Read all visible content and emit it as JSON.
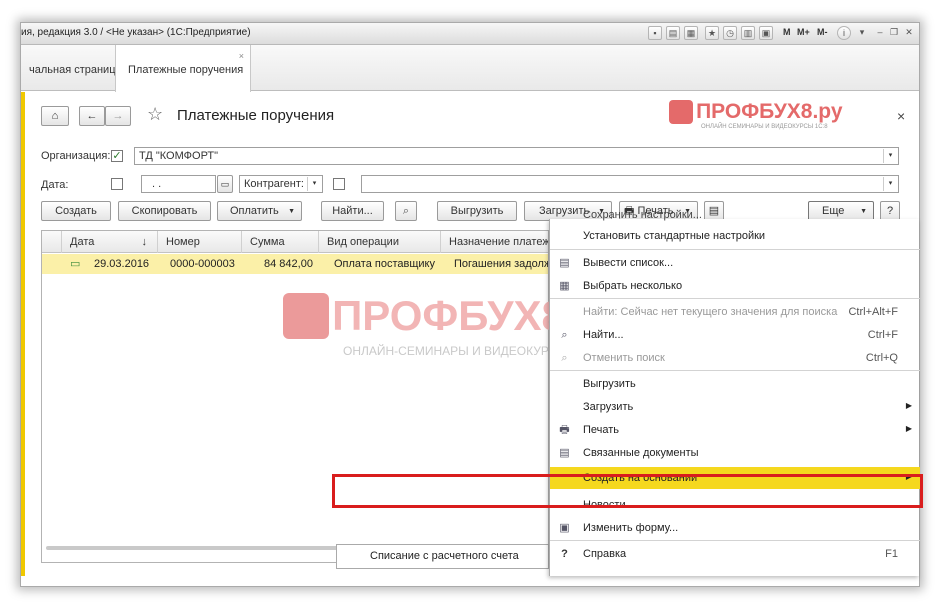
{
  "window": {
    "title": "ия, редакция 3.0 / <Не указан> (1С:Предприятие)",
    "tools": {
      "m": "M",
      "mplus": "M+",
      "mminus": "M-"
    }
  },
  "tabs": [
    {
      "label": "чальная страница"
    },
    {
      "label": "Платежные поручения",
      "close": "×"
    }
  ],
  "form": {
    "title": "Платежные поручения",
    "close": "×",
    "org_label": "Организация:",
    "org_value": "ТД \"КОМФОРТ\"",
    "date_label": "Дата:",
    "date_value": ". .",
    "contr_label": "Контрагент:"
  },
  "toolbar": {
    "create": "Создать",
    "copy": "Скопировать",
    "pay": "Оплатить",
    "find": "Найти...",
    "export": "Выгрузить",
    "import": "Загрузить",
    "print": "Печать",
    "more": "Еще",
    "help": "?"
  },
  "table": {
    "columns": [
      "Дата",
      "Номер",
      "Сумма",
      "Вид операции",
      "Назначение платежа"
    ],
    "sort_mark": "↓",
    "rows": [
      {
        "date": "29.03.2016",
        "number": "0000-000003",
        "sum": "84 842,00",
        "op": "Оплата поставщику",
        "purpose": "Погашения задолженности"
      }
    ]
  },
  "menu": {
    "items": [
      {
        "label": "Сохранить настройки..."
      },
      {
        "label": "Установить стандартные настройки"
      },
      {
        "label": "Вывести список..."
      },
      {
        "label": "Выбрать несколько"
      },
      {
        "label": "Найти: Сейчас нет текущего значения для поиска",
        "shortcut": "Ctrl+Alt+F"
      },
      {
        "label": "Найти...",
        "shortcut": "Ctrl+F"
      },
      {
        "label": "Отменить поиск",
        "shortcut": "Ctrl+Q"
      },
      {
        "label": "Выгрузить"
      },
      {
        "label": "Загрузить"
      },
      {
        "label": "Печать"
      },
      {
        "label": "Связанные документы"
      },
      {
        "label": "Создать на основании"
      },
      {
        "label": "Новости"
      },
      {
        "label": "Изменить форму..."
      },
      {
        "label": "Справка",
        "shortcut": "F1"
      }
    ]
  },
  "submenu": {
    "item": "Списание с расчетного счета"
  },
  "watermark": {
    "brand": "ПРОФБУХ8.ру",
    "tagline_small": "ОНЛАЙН СЕМИНАРЫ И ВИДЕОКУРСЫ 1С:8",
    "tagline": "ОНЛАЙН-СЕМИНАРЫ И ВИДЕОКУРСЫ 1С:8"
  },
  "colors": {
    "highlight": "#f5d81e",
    "row": "#fbf0a8",
    "accent": "#f0c800",
    "red_frame": "#d91d1d"
  }
}
